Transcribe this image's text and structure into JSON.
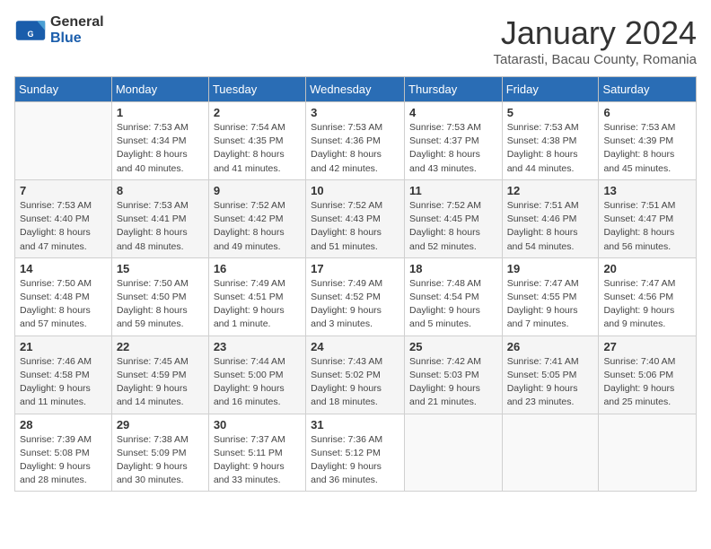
{
  "logo": {
    "line1": "General",
    "line2": "Blue"
  },
  "title": "January 2024",
  "subtitle": "Tatarasti, Bacau County, Romania",
  "days_of_week": [
    "Sunday",
    "Monday",
    "Tuesday",
    "Wednesday",
    "Thursday",
    "Friday",
    "Saturday"
  ],
  "weeks": [
    [
      {
        "day": "",
        "sunrise": "",
        "sunset": "",
        "daylight": ""
      },
      {
        "day": "1",
        "sunrise": "Sunrise: 7:53 AM",
        "sunset": "Sunset: 4:34 PM",
        "daylight": "Daylight: 8 hours and 40 minutes."
      },
      {
        "day": "2",
        "sunrise": "Sunrise: 7:54 AM",
        "sunset": "Sunset: 4:35 PM",
        "daylight": "Daylight: 8 hours and 41 minutes."
      },
      {
        "day": "3",
        "sunrise": "Sunrise: 7:53 AM",
        "sunset": "Sunset: 4:36 PM",
        "daylight": "Daylight: 8 hours and 42 minutes."
      },
      {
        "day": "4",
        "sunrise": "Sunrise: 7:53 AM",
        "sunset": "Sunset: 4:37 PM",
        "daylight": "Daylight: 8 hours and 43 minutes."
      },
      {
        "day": "5",
        "sunrise": "Sunrise: 7:53 AM",
        "sunset": "Sunset: 4:38 PM",
        "daylight": "Daylight: 8 hours and 44 minutes."
      },
      {
        "day": "6",
        "sunrise": "Sunrise: 7:53 AM",
        "sunset": "Sunset: 4:39 PM",
        "daylight": "Daylight: 8 hours and 45 minutes."
      }
    ],
    [
      {
        "day": "7",
        "sunrise": "Sunrise: 7:53 AM",
        "sunset": "Sunset: 4:40 PM",
        "daylight": "Daylight: 8 hours and 47 minutes."
      },
      {
        "day": "8",
        "sunrise": "Sunrise: 7:53 AM",
        "sunset": "Sunset: 4:41 PM",
        "daylight": "Daylight: 8 hours and 48 minutes."
      },
      {
        "day": "9",
        "sunrise": "Sunrise: 7:52 AM",
        "sunset": "Sunset: 4:42 PM",
        "daylight": "Daylight: 8 hours and 49 minutes."
      },
      {
        "day": "10",
        "sunrise": "Sunrise: 7:52 AM",
        "sunset": "Sunset: 4:43 PM",
        "daylight": "Daylight: 8 hours and 51 minutes."
      },
      {
        "day": "11",
        "sunrise": "Sunrise: 7:52 AM",
        "sunset": "Sunset: 4:45 PM",
        "daylight": "Daylight: 8 hours and 52 minutes."
      },
      {
        "day": "12",
        "sunrise": "Sunrise: 7:51 AM",
        "sunset": "Sunset: 4:46 PM",
        "daylight": "Daylight: 8 hours and 54 minutes."
      },
      {
        "day": "13",
        "sunrise": "Sunrise: 7:51 AM",
        "sunset": "Sunset: 4:47 PM",
        "daylight": "Daylight: 8 hours and 56 minutes."
      }
    ],
    [
      {
        "day": "14",
        "sunrise": "Sunrise: 7:50 AM",
        "sunset": "Sunset: 4:48 PM",
        "daylight": "Daylight: 8 hours and 57 minutes."
      },
      {
        "day": "15",
        "sunrise": "Sunrise: 7:50 AM",
        "sunset": "Sunset: 4:50 PM",
        "daylight": "Daylight: 8 hours and 59 minutes."
      },
      {
        "day": "16",
        "sunrise": "Sunrise: 7:49 AM",
        "sunset": "Sunset: 4:51 PM",
        "daylight": "Daylight: 9 hours and 1 minute."
      },
      {
        "day": "17",
        "sunrise": "Sunrise: 7:49 AM",
        "sunset": "Sunset: 4:52 PM",
        "daylight": "Daylight: 9 hours and 3 minutes."
      },
      {
        "day": "18",
        "sunrise": "Sunrise: 7:48 AM",
        "sunset": "Sunset: 4:54 PM",
        "daylight": "Daylight: 9 hours and 5 minutes."
      },
      {
        "day": "19",
        "sunrise": "Sunrise: 7:47 AM",
        "sunset": "Sunset: 4:55 PM",
        "daylight": "Daylight: 9 hours and 7 minutes."
      },
      {
        "day": "20",
        "sunrise": "Sunrise: 7:47 AM",
        "sunset": "Sunset: 4:56 PM",
        "daylight": "Daylight: 9 hours and 9 minutes."
      }
    ],
    [
      {
        "day": "21",
        "sunrise": "Sunrise: 7:46 AM",
        "sunset": "Sunset: 4:58 PM",
        "daylight": "Daylight: 9 hours and 11 minutes."
      },
      {
        "day": "22",
        "sunrise": "Sunrise: 7:45 AM",
        "sunset": "Sunset: 4:59 PM",
        "daylight": "Daylight: 9 hours and 14 minutes."
      },
      {
        "day": "23",
        "sunrise": "Sunrise: 7:44 AM",
        "sunset": "Sunset: 5:00 PM",
        "daylight": "Daylight: 9 hours and 16 minutes."
      },
      {
        "day": "24",
        "sunrise": "Sunrise: 7:43 AM",
        "sunset": "Sunset: 5:02 PM",
        "daylight": "Daylight: 9 hours and 18 minutes."
      },
      {
        "day": "25",
        "sunrise": "Sunrise: 7:42 AM",
        "sunset": "Sunset: 5:03 PM",
        "daylight": "Daylight: 9 hours and 21 minutes."
      },
      {
        "day": "26",
        "sunrise": "Sunrise: 7:41 AM",
        "sunset": "Sunset: 5:05 PM",
        "daylight": "Daylight: 9 hours and 23 minutes."
      },
      {
        "day": "27",
        "sunrise": "Sunrise: 7:40 AM",
        "sunset": "Sunset: 5:06 PM",
        "daylight": "Daylight: 9 hours and 25 minutes."
      }
    ],
    [
      {
        "day": "28",
        "sunrise": "Sunrise: 7:39 AM",
        "sunset": "Sunset: 5:08 PM",
        "daylight": "Daylight: 9 hours and 28 minutes."
      },
      {
        "day": "29",
        "sunrise": "Sunrise: 7:38 AM",
        "sunset": "Sunset: 5:09 PM",
        "daylight": "Daylight: 9 hours and 30 minutes."
      },
      {
        "day": "30",
        "sunrise": "Sunrise: 7:37 AM",
        "sunset": "Sunset: 5:11 PM",
        "daylight": "Daylight: 9 hours and 33 minutes."
      },
      {
        "day": "31",
        "sunrise": "Sunrise: 7:36 AM",
        "sunset": "Sunset: 5:12 PM",
        "daylight": "Daylight: 9 hours and 36 minutes."
      },
      {
        "day": "",
        "sunrise": "",
        "sunset": "",
        "daylight": ""
      },
      {
        "day": "",
        "sunrise": "",
        "sunset": "",
        "daylight": ""
      },
      {
        "day": "",
        "sunrise": "",
        "sunset": "",
        "daylight": ""
      }
    ]
  ]
}
